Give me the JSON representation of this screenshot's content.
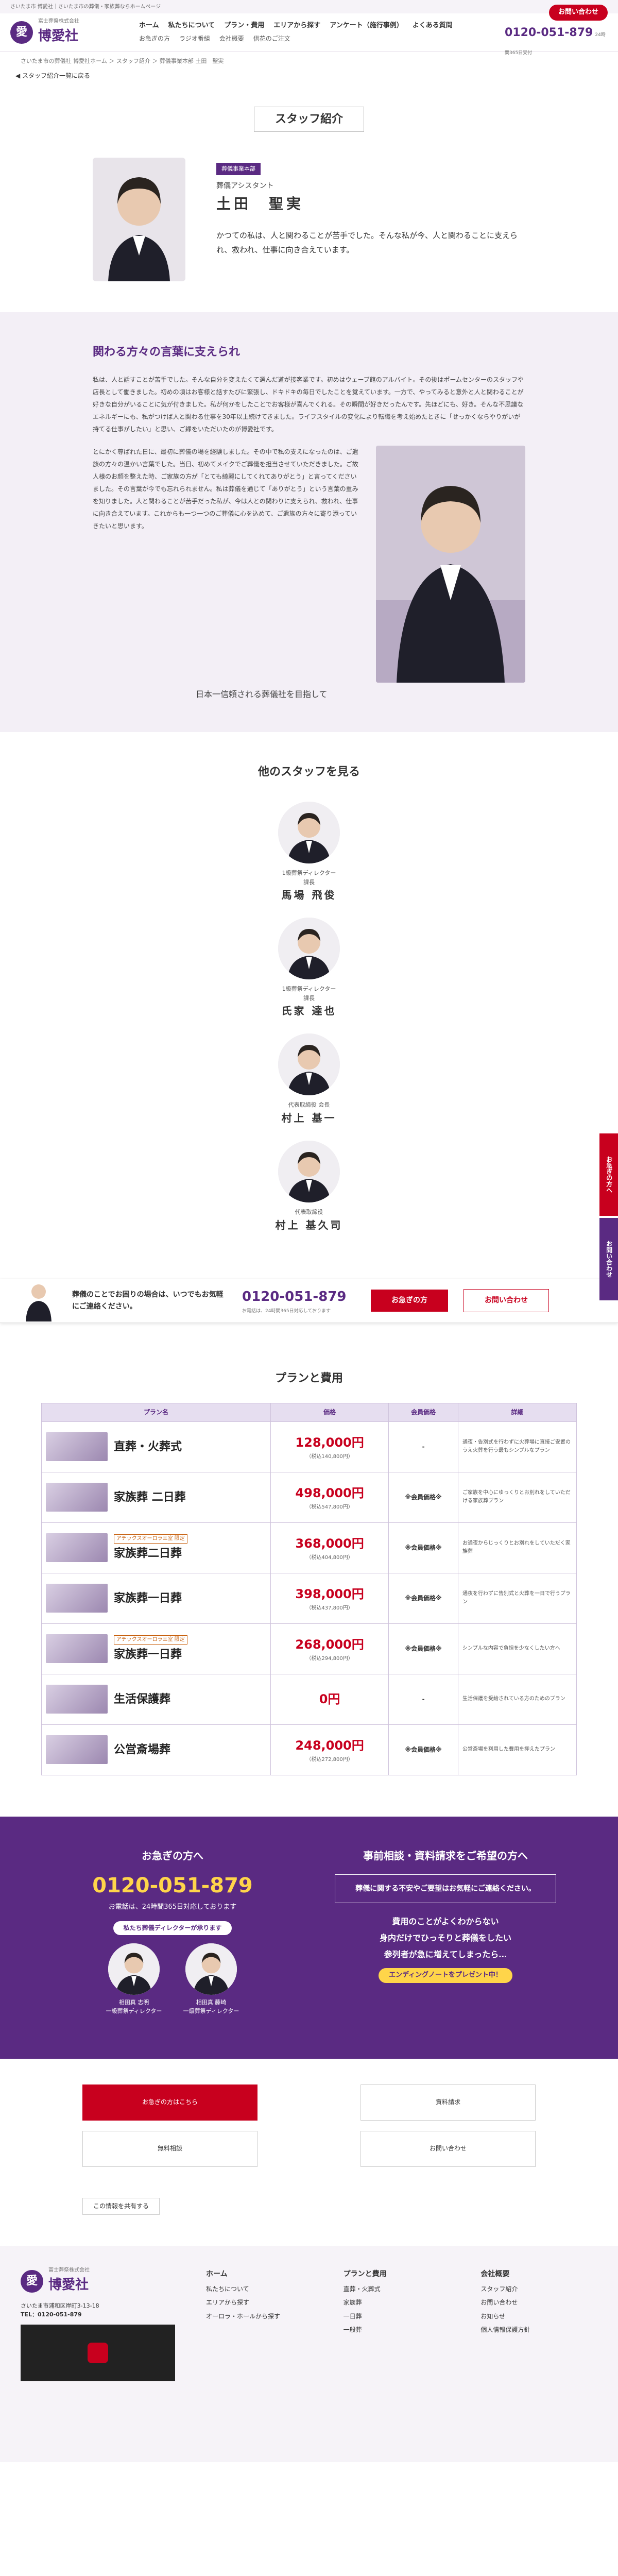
{
  "topstrip": "さいたま市 博愛社｜さいたま市の葬儀・家族葬ならホームページ",
  "header": {
    "logo_small": "富士葬祭株式会社",
    "logo_name": "博愛社",
    "nav_main": [
      "ホーム",
      "私たちについて",
      "プラン・費用",
      "エリアから探す",
      "アンケート（施行事例）",
      "よくある質問"
    ],
    "nav_sub": [
      "お急ぎの方",
      "ラジオ番組",
      "会社概要",
      "供花のご注文"
    ],
    "contact_btn": "お問い合わせ",
    "tel": "0120-051-879",
    "tel_note": "24時間365日受付"
  },
  "breadcrumb": "さいたま市の葬儀社 博愛社ホーム ＞ スタッフ紹介 ＞ 葬儀事業本部 土田　聖実",
  "back_link": "◀ スタッフ紹介一覧に戻る",
  "page_title": "スタッフ紹介",
  "profile": {
    "badge": "葬儀事業本部",
    "role": "葬儀アシスタント",
    "name": "土田　聖実",
    "quote": "かつての私は、人と関わることが苦手でした。そんな私が今、人と関わることに支えられ、救われ、仕事に向き合えています。"
  },
  "message": {
    "heading": "関わる方々の言葉に支えられ",
    "p1": "私は、人と話すことが苦手でした。そんな自分を変えたくて選んだ道が接客業です。初めはウェーブ館のアルバイト。その後はポームセンターのスタッフや店長として働きました。初めの頃はお客様と話すたびに緊張し、ドキドキの毎日でしたことを覚えています。一方で、やってみると意外と人と関わることが好きな自分がいることに気が付きました。私が何かをしたことでお客様が喜んでくれる。その瞬間が好きだったんです。先ほどにも、好き。そんな不思議なエネルギーにも、私がつけば人と関わる仕事を30年以上続けてきました。ライフスタイルの変化により転職を考え始めたときに「せっかくならやりがいが持てる仕事がしたい」と思い、ご縁をいただいたのが博愛社です。",
    "p2": "とにかく尊ばれた日に、最初に葬儀の場を経験しました。その中で私の支えになったのは、ご遺族の方々の温かい言葉でした。当日、初めてメイクでご葬儀を担当させていただきました。ご故人様のお顔を整えた時、ご家族の方が「とても綺麗にしてくれてありがとう」と言ってくださいました。その言葉が今でも忘れられません。私は葬儀を通じて「ありがとう」という言葉の重みを知りました。人と関わることが苦手だった私が、今は人との関わりに支えられ、救われ、仕事に向き合えています。これからも一つ一つのご葬儀に心を込めて、ご遺族の方々に寄り添っていきたいと思います。",
    "catch": "日本一信頼される葬儀社を目指して"
  },
  "others": {
    "heading": "他のスタッフを見る",
    "staff": [
      {
        "role": "1級葬祭ディレクター\n課長",
        "name": "馬場 飛俊"
      },
      {
        "role": "1級葬祭ディレクター\n課長",
        "name": "氏家 達也"
      },
      {
        "role": "代表取締役 会長",
        "name": "村上 基一"
      },
      {
        "role": "代表取締役",
        "name": "村上 基久司"
      }
    ]
  },
  "float_cta": {
    "msg": "葬儀のことでお困りの場合は、いつでもお気軽にご連絡ください。",
    "tel": "0120-051-879",
    "tel_note": "お電話は、24時間365日対応しております",
    "btn1": "お急ぎの方",
    "btn2": "お問い合わせ"
  },
  "side_tabs": [
    "お急ぎの方へ",
    "お問い合わせ"
  ],
  "plans": {
    "heading": "プランと費用",
    "cols": [
      "プラン名",
      "価格",
      "会員価格",
      "詳細"
    ],
    "rows": [
      {
        "tag": "",
        "name": "直葬・火葬式",
        "price": "128,000円",
        "tax": "（税込140,800円）",
        "member": "-",
        "detail": "通夜・告別式を行わずに火葬場に直接ご安置のうえ火葬を行う最もシンプルなプラン"
      },
      {
        "tag": "",
        "name": "家族葬 二日葬",
        "price": "498,000円",
        "tax": "（税込547,800円）",
        "member": "※会員価格※",
        "detail": "ご家族を中心にゆっくりとお別れをしていただける家族葬プラン"
      },
      {
        "tag": "アチックスオーロラ三室 限定",
        "name": "家族葬二日葬",
        "price": "368,000円",
        "tax": "（税込404,800円）",
        "member": "※会員価格※",
        "detail": "お通夜からじっくりとお別れをしていただく家族葬"
      },
      {
        "tag": "",
        "name": "家族葬一日葬",
        "price": "398,000円",
        "tax": "（税込437,800円）",
        "member": "※会員価格※",
        "detail": "通夜を行わずに告別式と火葬を一日で行うプラン"
      },
      {
        "tag": "アチックスオーロラ三室 限定",
        "name": "家族葬一日葬",
        "price": "268,000円",
        "tax": "（税込294,800円）",
        "member": "※会員価格※",
        "detail": "シンプルな内容で負担を少なくしたい方へ"
      },
      {
        "tag": "",
        "name": "生活保護葬",
        "price": "0円",
        "tax": "",
        "member": "-",
        "detail": "生活保護を受給されている方のためのプラン"
      },
      {
        "tag": "",
        "name": "公営斎場葬",
        "price": "248,000円",
        "tax": "（税込272,800円）",
        "member": "※会員価格※",
        "detail": "公営斎場を利用した費用を抑えたプラン"
      }
    ]
  },
  "contact_band": {
    "left_h": "お急ぎの方へ",
    "tel": "0120-051-879",
    "tel_sub": "お電話は、24時間365日対応しております",
    "pill": "私たち葬儀ディレクターが承ります",
    "people": [
      {
        "name": "相田真 志明",
        "role": "一級葬祭ディレクター"
      },
      {
        "name": "相田真 藤崎",
        "role": "一級葬祭ディレクター"
      }
    ],
    "right_h": "事前相談・資料請求をご希望の方へ",
    "box": "葬儀に関する不安やご要望はお気軽にご連絡ください。",
    "list": [
      "費用のことがよくわからない",
      "身内だけでひっそりと葬儀をしたい",
      "参列者が急に増えてしまったら…"
    ],
    "yellow": "エンディングノートをプレゼント中！"
  },
  "links": [
    "お急ぎの方はこちら",
    "資料請求",
    "無料相談",
    "お問い合わせ"
  ],
  "share_label": "この情報を共有する",
  "footer": {
    "company_small": "富士葬祭株式会社",
    "company": "博愛社",
    "address": "さいたま市浦和区岸町3-13-18",
    "tel": "TEL：0120-051-879",
    "col1": [
      "ホーム",
      "私たちについて",
      "エリアから探す",
      "オーロラ・ホールから探す"
    ],
    "col2": [
      "プランと費用",
      "直葬・火葬式",
      "家族葬",
      "一日葬",
      "一般葬"
    ],
    "col3": [
      "会社概要",
      "スタッフ紹介",
      "お問い合わせ",
      "お知らせ",
      "個人情報保護方針"
    ]
  }
}
